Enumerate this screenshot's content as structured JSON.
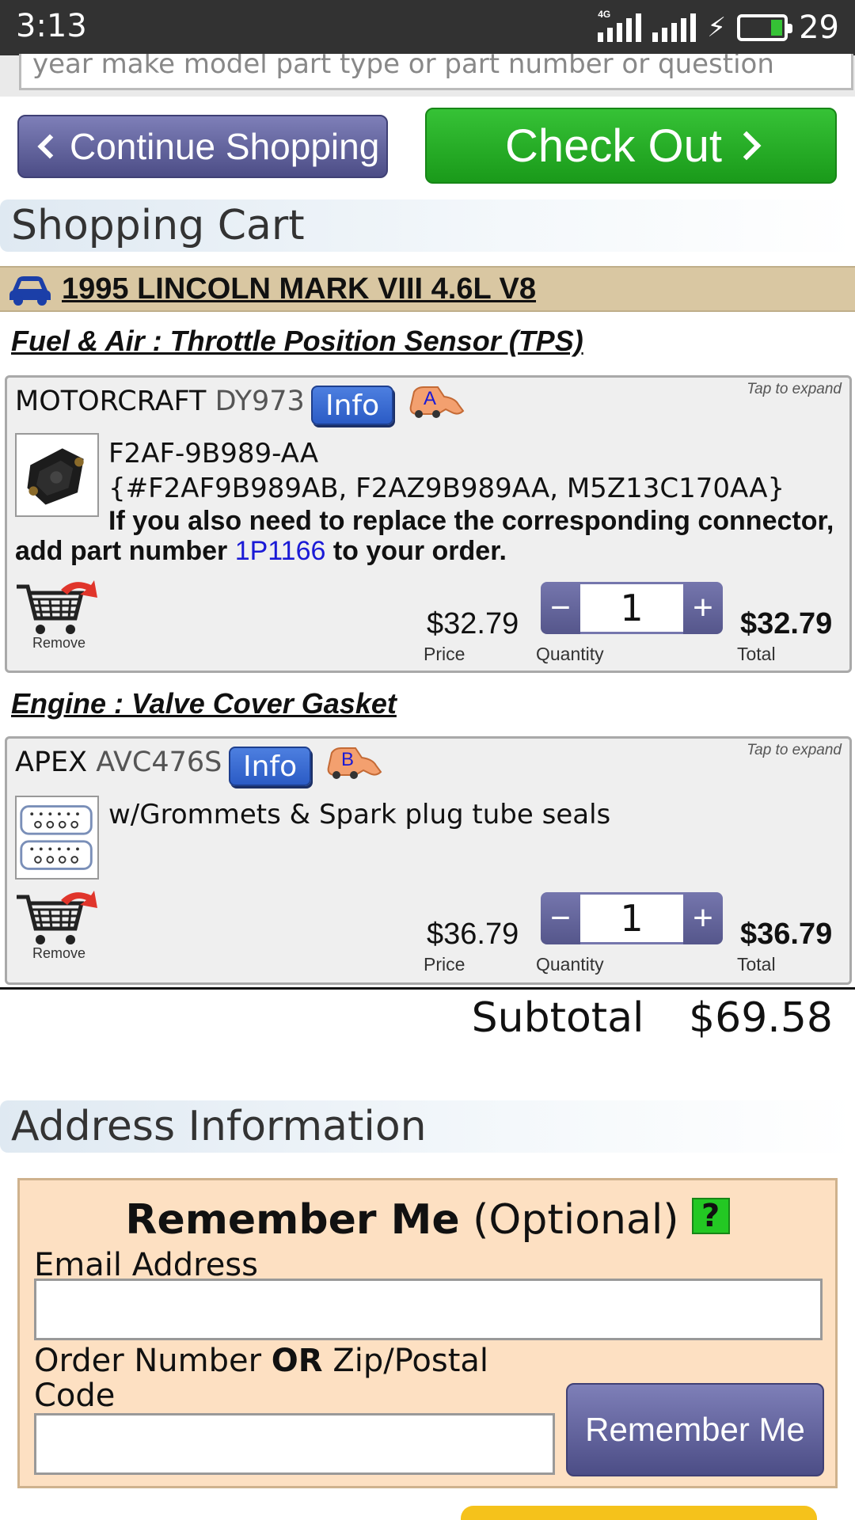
{
  "status_bar": {
    "time": "3:13",
    "network": "4G",
    "battery_level": "29",
    "battery_color": "#35c235"
  },
  "search": {
    "placeholder": "year make model part type or part number or question"
  },
  "nav": {
    "continue_label": "Continue Shopping",
    "checkout_label": "Check Out"
  },
  "cart": {
    "heading": "Shopping Cart",
    "vehicle": "1995 LINCOLN MARK VIII 4.6L V8",
    "items": [
      {
        "category": "Fuel & Air : Throttle Position Sensor (TPS)",
        "brand": "MOTORCRAFT",
        "part_number": "DY973",
        "info_label": "Info",
        "badge": "A",
        "tap_hint": "Tap to expand",
        "desc_line1": "F2AF-9B989-AA",
        "desc_line2": "{#F2AF9B989AB, F2AZ9B989AA, M5Z13C170AA}",
        "note_prefix": "If you also need to replace the corresponding connector, add part number",
        "note_link": "1P1166",
        "note_suffix": "to your order.",
        "remove_label": "Remove",
        "price": "$32.79",
        "price_label": "Price",
        "quantity": "1",
        "quantity_label": "Quantity",
        "total": "$32.79",
        "total_label": "Total"
      },
      {
        "category": "Engine : Valve Cover Gasket",
        "brand": "APEX",
        "part_number": "AVC476S",
        "info_label": "Info",
        "badge": "B",
        "tap_hint": "Tap to expand",
        "desc_line1": "w/Grommets & Spark plug tube seals",
        "remove_label": "Remove",
        "price": "$36.79",
        "price_label": "Price",
        "quantity": "1",
        "quantity_label": "Quantity",
        "total": "$36.79",
        "total_label": "Total"
      }
    ],
    "subtotal_label": "Subtotal",
    "subtotal_value": "$69.58"
  },
  "address": {
    "heading": "Address Information",
    "remember_title_bold": "Remember Me",
    "remember_title_rest": "(Optional)",
    "help_icon": "?",
    "email_label": "Email Address",
    "order_label_a": "Order Number",
    "order_label_or": "OR",
    "order_label_b": "Zip/Postal Code",
    "remember_button": "Remember Me"
  },
  "colors": {
    "checkout_green": "#1fa81f",
    "nav_purple": "#5f60a0",
    "info_blue": "#2f62cc",
    "vehicle_tan": "#d9c7a2",
    "remember_peach": "#fde0c2",
    "link_blue": "#1a1ad6"
  },
  "quantity_controls": {
    "minus": "−",
    "plus": "+"
  }
}
